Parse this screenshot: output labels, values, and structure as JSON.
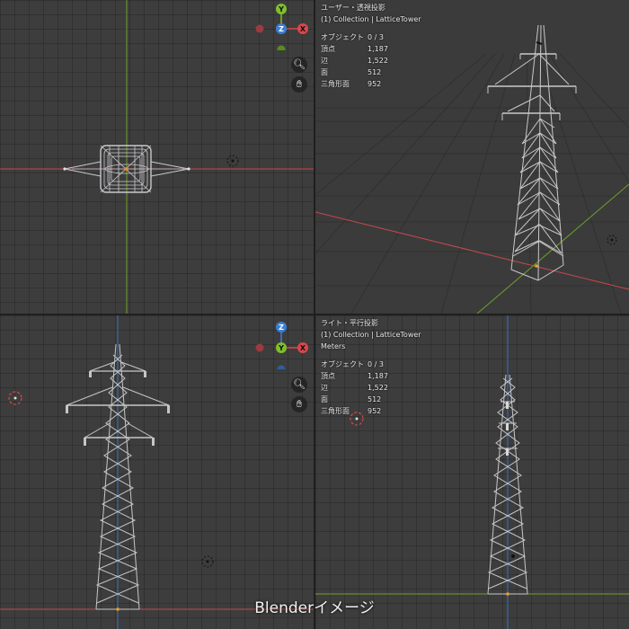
{
  "viewports": {
    "top": {
      "gizmo": {
        "y": "Y",
        "z": "Z",
        "x": "X"
      }
    },
    "perspective": {
      "view_title": "ユーザー・透視投影",
      "collection": "(1) Collection | LatticeTower",
      "stats": [
        {
          "label": "オブジェクト",
          "value": "0 / 3"
        },
        {
          "label": "頂点",
          "value": "1,187"
        },
        {
          "label": "辺",
          "value": "1,522"
        },
        {
          "label": "面",
          "value": "512"
        },
        {
          "label": "三角形面",
          "value": "952"
        }
      ]
    },
    "front": {
      "gizmo": {
        "z": "Z",
        "y": "Y",
        "x": "X"
      }
    },
    "right": {
      "view_title": "ライト・平行投影",
      "collection": "(1) Collection | LatticeTower",
      "units": "Meters",
      "stats": [
        {
          "label": "オブジェクト",
          "value": "0 / 3"
        },
        {
          "label": "頂点",
          "value": "1,187"
        },
        {
          "label": "辺",
          "value": "1,522"
        },
        {
          "label": "面",
          "value": "512"
        },
        {
          "label": "三角形面",
          "value": "952"
        }
      ]
    }
  },
  "caption": "Blenderイメージ",
  "colors": {
    "axis_x": "#d8474c",
    "axis_y": "#7fbf2a",
    "axis_z": "#3a7fd6",
    "wire": "#c6c6c6"
  }
}
